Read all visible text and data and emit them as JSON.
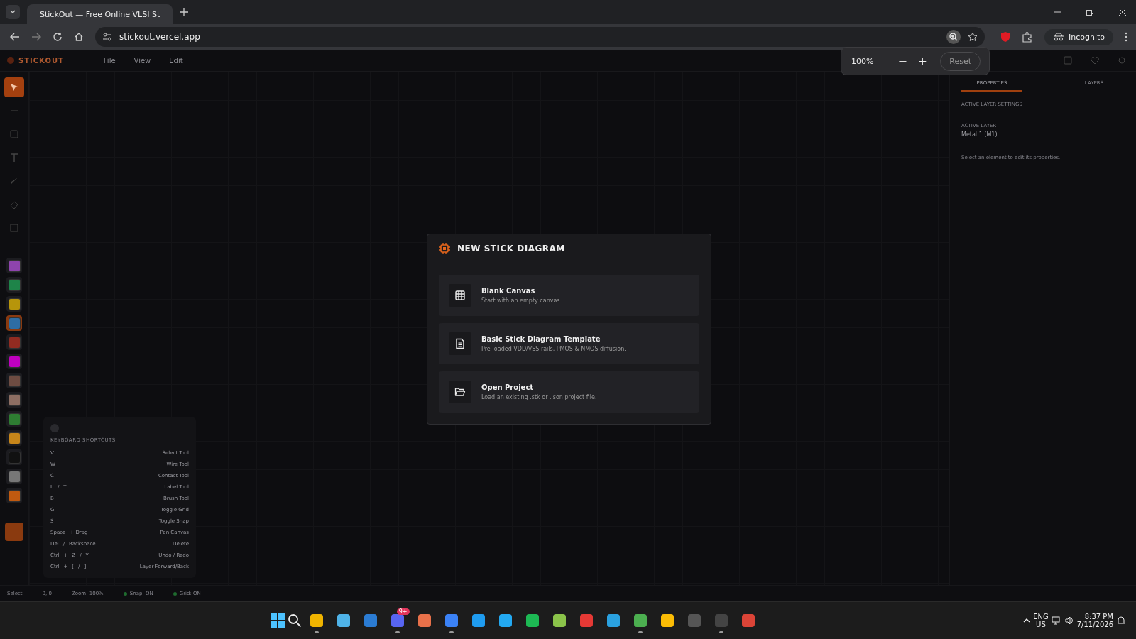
{
  "browser": {
    "tab_title": "StickOut — Free Online VLSI St",
    "url": "stickout.vercel.app",
    "profile": "Incognito",
    "zoom_popup": {
      "value": "100%",
      "minus": "−",
      "plus": "+",
      "reset": "Reset"
    }
  },
  "app": {
    "brand": "STICKOUT",
    "menu": [
      "File",
      "View",
      "Edit"
    ],
    "tools": [
      {
        "kind": "select",
        "selected": true
      },
      {
        "kind": "line",
        "selected": false
      },
      {
        "kind": "rect",
        "selected": false
      },
      {
        "kind": "text",
        "selected": false
      },
      {
        "kind": "brush",
        "selected": false
      },
      {
        "kind": "eraser",
        "selected": false
      },
      {
        "kind": "contact",
        "selected": false
      }
    ],
    "layers": [
      {
        "color": "#8e44ad",
        "selected": false
      },
      {
        "color": "#1e8449",
        "selected": false
      },
      {
        "color": "#b7950b",
        "selected": false
      },
      {
        "color": "#2e6da4",
        "selected": true
      },
      {
        "color": "#922b21",
        "selected": false
      },
      {
        "color": "#c000c0",
        "selected": false
      },
      {
        "color": "#6e4c42",
        "selected": false
      },
      {
        "color": "#8d6e63",
        "selected": false
      },
      {
        "color": "#2e7d32",
        "selected": false
      },
      {
        "color": "#c7861a",
        "selected": false
      },
      {
        "color": "#111111",
        "selected": false
      },
      {
        "color": "#777777",
        "selected": false
      },
      {
        "color": "#c05a10",
        "selected": false
      }
    ],
    "shortcuts": {
      "title": "KEYBOARD SHORTCUTS",
      "rows": [
        {
          "keys": [
            "V"
          ],
          "action": "Select Tool"
        },
        {
          "keys": [
            "W"
          ],
          "action": "Wire Tool"
        },
        {
          "keys": [
            "C"
          ],
          "action": "Contact Tool"
        },
        {
          "keys": [
            "L",
            "/",
            "T"
          ],
          "action": "Label Tool"
        },
        {
          "keys": [
            "B"
          ],
          "action": "Brush Tool"
        },
        {
          "keys": [
            "G"
          ],
          "action": "Toggle Grid"
        },
        {
          "keys": [
            "S"
          ],
          "action": "Toggle Snap"
        },
        {
          "keys": [
            "Space",
            "+ Drag"
          ],
          "action": "Pan Canvas"
        },
        {
          "keys": [
            "Del",
            "/",
            "Backspace"
          ],
          "action": "Delete"
        },
        {
          "keys": [
            "Ctrl",
            "+",
            "Z",
            "/",
            "Y"
          ],
          "action": "Undo / Redo"
        },
        {
          "keys": [
            "Ctrl",
            "+",
            "[",
            "/",
            "]"
          ],
          "action": "Layer Forward/Back"
        }
      ]
    },
    "panel": {
      "tabs": [
        {
          "label": "PROPERTIES",
          "selected": true
        },
        {
          "label": "LAYERS",
          "selected": false
        }
      ],
      "section": "ACTIVE LAYER SETTINGS",
      "field_label": "ACTIVE LAYER",
      "field_value": "Metal 1 (M1)",
      "hint": "Select an element to edit its properties."
    },
    "status": {
      "left": [
        "Select",
        "0, 0",
        "Zoom: 100%"
      ],
      "flags": [
        {
          "label": "Snap: ON",
          "on": true
        },
        {
          "label": "Grid: ON",
          "on": true
        }
      ]
    }
  },
  "modal": {
    "title": "NEW STICK DIAGRAM",
    "options": [
      {
        "kind": "blank",
        "title": "Blank Canvas",
        "description": "Start with an empty canvas."
      },
      {
        "kind": "template",
        "title": "Basic Stick Diagram Template",
        "description": "Pre-loaded VDD/VSS rails, PMOS & NMOS diffusion."
      },
      {
        "kind": "open",
        "title": "Open Project",
        "description": "Load an existing .stk or .json project file."
      }
    ]
  },
  "taskbar": {
    "apps": [
      {
        "color": "#f0b400",
        "running": true
      },
      {
        "color": "#4fb3e8",
        "running": false
      },
      {
        "color": "#2b7cd3",
        "running": false
      },
      {
        "color": "#5865f2",
        "running": true
      },
      {
        "color": "#e8714a",
        "running": false
      },
      {
        "color": "#3b82f6",
        "running": true
      },
      {
        "color": "#1f9cf0",
        "running": false
      },
      {
        "color": "#23a9f2",
        "running": false
      },
      {
        "color": "#1db954",
        "running": false
      },
      {
        "color": "#8bc34a",
        "running": false
      },
      {
        "color": "#e53935",
        "running": false
      },
      {
        "color": "#2aa1e0",
        "running": false
      },
      {
        "color": "#4caf50",
        "running": true
      },
      {
        "color": "#fbbc05",
        "running": false
      },
      {
        "color": "#555555",
        "running": false
      },
      {
        "color": "#444444",
        "running": true
      },
      {
        "color": "#db4437",
        "running": false
      }
    ],
    "badge": "9+",
    "lang": "ENG",
    "region": "US",
    "time": "8:37 PM",
    "date": "7/11/2026"
  }
}
